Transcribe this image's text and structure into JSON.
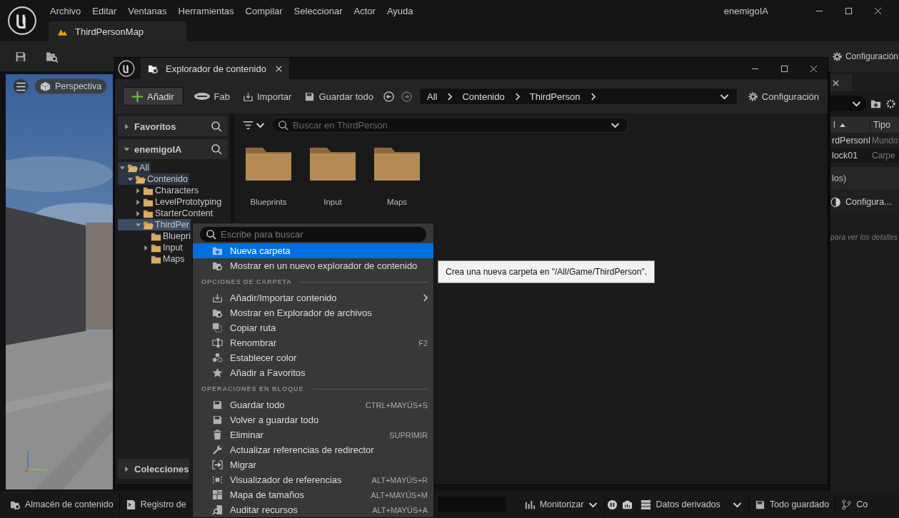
{
  "editor": {
    "menu": [
      "Archivo",
      "Editar",
      "Ventanas",
      "Herramientas",
      "Compilar",
      "Seleccionar",
      "Actor",
      "Ayuda"
    ],
    "project": "enemigoIA",
    "level_tab": "ThirdPersonMap",
    "toolbar_settings": "Configuración"
  },
  "viewport": {
    "view_mode": "Perspectiva"
  },
  "outliner": {
    "columns": [
      {
        "label": "l",
        "sorted": true
      },
      {
        "label": "Tipo",
        "sorted": false
      }
    ],
    "rows": [
      {
        "name": "rdPersonI",
        "type": "Mundo"
      },
      {
        "name": "lock01",
        "type": "Carpe"
      }
    ],
    "summary": "los)",
    "settings": "Configura...",
    "hint": "para ver los detalles"
  },
  "content_browser": {
    "tab": "Explorador de contenido",
    "toolbar": {
      "add": "Añadir",
      "buttons": [
        "Fab",
        "Importar",
        "Guardar todo"
      ],
      "breadcrumb": [
        "All",
        "Contenido",
        "ThirdPerson"
      ],
      "settings": "Configuración"
    },
    "sections": [
      {
        "title": "Favoritos",
        "expanded": false
      },
      {
        "title": "enemigoIA",
        "expanded": true
      }
    ],
    "tree": [
      {
        "label": "All",
        "expanded": true,
        "has_children": true,
        "selected": false,
        "in_path": true,
        "children": [
          {
            "label": "Contenido",
            "expanded": true,
            "has_children": true,
            "selected": false,
            "in_path": true,
            "children": [
              {
                "label": "Characters",
                "expanded": false,
                "has_children": true,
                "selected": false,
                "in_path": false
              },
              {
                "label": "LevelPrototyping",
                "expanded": false,
                "has_children": true,
                "selected": false,
                "in_path": false
              },
              {
                "label": "StarterContent",
                "expanded": false,
                "has_children": true,
                "selected": false,
                "in_path": false
              },
              {
                "label": "ThirdPer",
                "expanded": true,
                "has_children": true,
                "selected": true,
                "in_path": false,
                "children": [
                  {
                    "label": "Bluepri",
                    "expanded": false,
                    "has_children": false,
                    "selected": false,
                    "in_path": false
                  },
                  {
                    "label": "Input",
                    "expanded": false,
                    "has_children": true,
                    "selected": false,
                    "in_path": false
                  },
                  {
                    "label": "Maps",
                    "expanded": false,
                    "has_children": false,
                    "selected": false,
                    "in_path": false
                  }
                ]
              }
            ]
          }
        ]
      }
    ],
    "collections": "Colecciones",
    "search": {
      "placeholder": "Buscar en ThirdPerson"
    },
    "folders": [
      "Blueprints",
      "Input",
      "Maps"
    ]
  },
  "context_menu": {
    "search": {
      "placeholder": "Escribe para buscar"
    },
    "items": [
      {
        "kind": "item",
        "label": "Nueva carpeta",
        "selected": true
      },
      {
        "kind": "item",
        "label": "Mostrar en un nuevo explorador de contenido",
        "selected": false
      },
      {
        "kind": "section",
        "label": "OPCIONES DE CARPETA"
      },
      {
        "kind": "item",
        "label": "Añadir/Importar contenido",
        "selected": false,
        "submenu": true
      },
      {
        "kind": "item",
        "label": "Mostrar en Explorador de archivos",
        "selected": false
      },
      {
        "kind": "item",
        "label": "Copiar ruta",
        "selected": false
      },
      {
        "kind": "item",
        "label": "Renombrar",
        "selected": false,
        "shortcut": "F2"
      },
      {
        "kind": "item",
        "label": "Establecer color",
        "selected": false
      },
      {
        "kind": "item",
        "label": "Añadir a Favoritos",
        "selected": false
      },
      {
        "kind": "section",
        "label": "OPERACIONES EN BLOQUE"
      },
      {
        "kind": "item",
        "label": "Guardar todo",
        "selected": false,
        "shortcut": "CTRL+MAYÚS+S"
      },
      {
        "kind": "item",
        "label": "Volver a guardar todo",
        "selected": false
      },
      {
        "kind": "item",
        "label": "Eliminar",
        "selected": false,
        "shortcut": "SUPRIMIR"
      },
      {
        "kind": "item",
        "label": "Actualizar referencias de redirector",
        "selected": false
      },
      {
        "kind": "item",
        "label": "Migrar",
        "selected": false
      },
      {
        "kind": "item",
        "label": "Visualizador de referencias",
        "selected": false,
        "shortcut": "ALT+MAYÚS+R"
      },
      {
        "kind": "item",
        "label": "Mapa de tamaños",
        "selected": false,
        "shortcut": "ALT+MAYÚS+M"
      },
      {
        "kind": "item",
        "label": "Auditar recursos",
        "selected": false,
        "shortcut": "ALT+MAYÚS+A"
      }
    ]
  },
  "tooltip": "Crea una nueva carpeta en \"/All/Game/ThirdPerson\".",
  "status_bar": {
    "left": [
      "Almacén de contenido",
      "Registro de"
    ],
    "right": [
      "Monitorizar",
      "Datos derivados",
      "Todo guardado",
      "Co"
    ]
  }
}
